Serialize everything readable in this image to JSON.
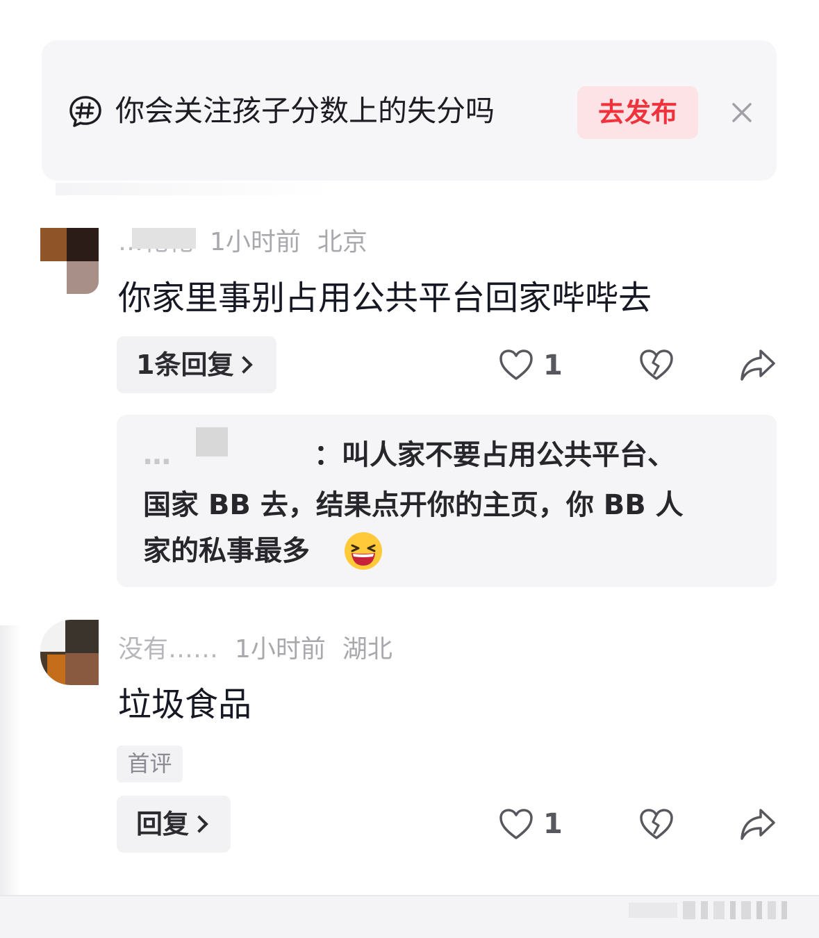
{
  "topic_banner": {
    "text": "你会关注孩子分数上的失分吗",
    "publish_label": "去发布",
    "icon": "hashtag-chat-icon",
    "close_icon": "close-icon"
  },
  "comments": [
    {
      "username": "…花花",
      "time": "1小时前",
      "location": "北京",
      "text": "你家里事别占用公共平台回家哔哔去",
      "reply_button_label": "1条回复",
      "like_count": "1",
      "reply_preview": {
        "author_prefix": "…",
        "line1": "：叫人家不要占用公共平台、",
        "line2": "国家 BB 去，结果点开你的主页，你 BB 人",
        "line3": "家的私事最多",
        "emoji": "laughing-emoji"
      }
    },
    {
      "username": "没有……",
      "time": "1小时前",
      "location": "湖北",
      "text": "垃圾食品",
      "badge": "首评",
      "reply_button_label": "回复",
      "like_count": "1"
    }
  ],
  "colors": {
    "accent_red": "#f0323c",
    "publish_bg": "#fde3e6",
    "banner_bg": "#f6f6f8",
    "meta_gray": "#a8a8ad"
  }
}
